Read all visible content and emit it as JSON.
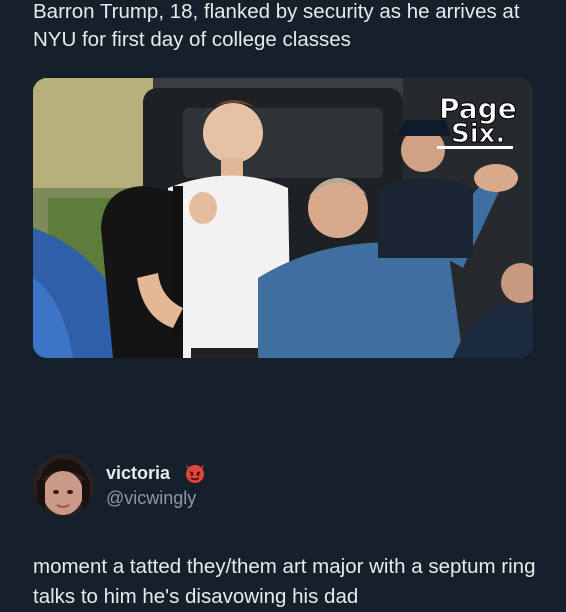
{
  "quoted_post": {
    "text": "Barron Trump, 18, flanked by security as he arrives at NYU for first day of college classes",
    "media": {
      "watermark_line1": "Page",
      "watermark_line2": "Six."
    }
  },
  "reply": {
    "author": {
      "display_name": "victoria",
      "badge_icon": "demon-emoji-icon",
      "handle": "@vicwingly"
    },
    "text": "moment a tatted they/them art major with a septum ring talks to him he's disavowing his dad"
  }
}
